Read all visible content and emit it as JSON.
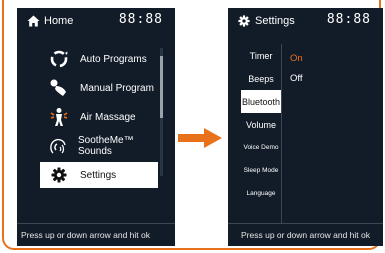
{
  "colors": {
    "accent": "#e8711c",
    "screen_bg": "#121c28",
    "selected_bg": "#ffffff"
  },
  "left_screen": {
    "header": {
      "icon": "home-icon",
      "title": "Home",
      "clock": "88:88"
    },
    "menu": [
      {
        "label": "Auto Programs",
        "icon": "auto-programs-icon"
      },
      {
        "label": "Manual Program",
        "icon": "manual-program-icon"
      },
      {
        "label": "Air Massage",
        "icon": "air-massage-icon"
      },
      {
        "label": "SootheMe™ Sounds",
        "icon": "sounds-icon"
      },
      {
        "label": "Settings",
        "icon": "gear-icon",
        "selected": true
      }
    ],
    "footer": "Press up or down arrow and hit ok"
  },
  "right_screen": {
    "header": {
      "icon": "gear-icon",
      "title": "Settings",
      "clock": "88:88"
    },
    "side_menu": [
      {
        "label": "Timer"
      },
      {
        "label": "Beeps"
      },
      {
        "label": "Bluetooth",
        "selected": true
      },
      {
        "label": "Volume"
      },
      {
        "label": "Voice Demo"
      },
      {
        "label": "Sleep Mode"
      },
      {
        "label": "Language"
      }
    ],
    "options": [
      {
        "label": "On",
        "active": true
      },
      {
        "label": "Off",
        "active": false
      }
    ],
    "footer": "Press up or down arrow and hit ok"
  },
  "transition_icon": "arrow-right-icon"
}
